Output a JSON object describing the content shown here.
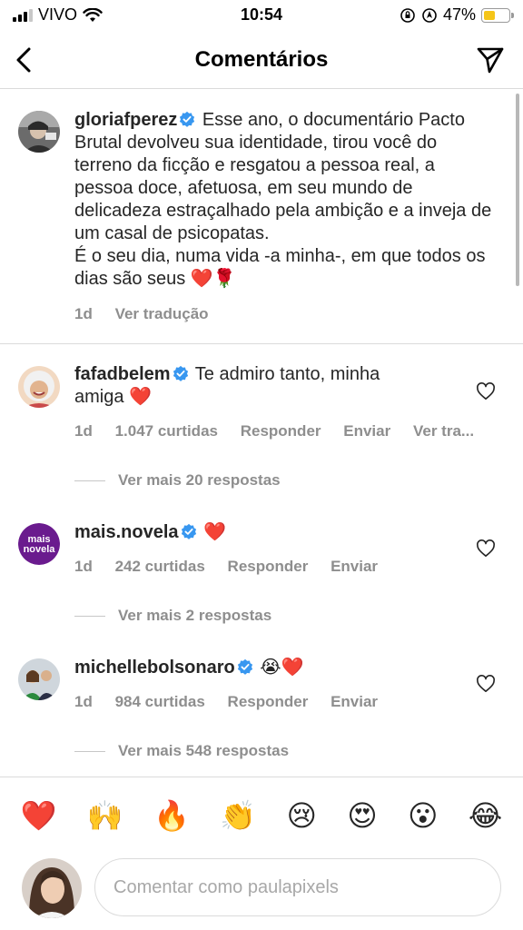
{
  "status_bar": {
    "carrier": "VIVO",
    "time": "10:54",
    "battery_percent": "47%",
    "battery_level": 0.47,
    "battery_color": "#f5c518"
  },
  "header": {
    "title": "Comentários"
  },
  "caption": {
    "username": "gloriafperez",
    "text": "Esse ano, o documentário Pacto Brutal devolveu sua identidade, tirou você do terreno da ficção e resgatou a pessoa real, a pessoa doce, afetuosa, em seu mundo de delicadeza  estraçalhado pela ambição e a inveja de um casal de psicopatas.",
    "text2": "É o seu dia, numa vida -a minha-, em que todos os dias são seus ❤️🌹",
    "time": "1d",
    "translate_label": "Ver tradução"
  },
  "comments": [
    {
      "username": "fafadbelem",
      "text": "Te admiro tanto, minha amiga ❤️",
      "time": "1d",
      "likes": "1.047 curtidas",
      "reply_label": "Responder",
      "send_label": "Enviar",
      "translate_label": "Ver tra...",
      "more_replies": "Ver mais 20 respostas"
    },
    {
      "username": "mais.novela",
      "text": "❤️",
      "time": "1d",
      "likes": "242 curtidas",
      "reply_label": "Responder",
      "send_label": "Enviar",
      "more_replies": "Ver mais 2 respostas",
      "avatar_text_1": "mais",
      "avatar_text_2": "novela",
      "avatar_color": "#6a1b8e"
    },
    {
      "username": "michellebolsonaro",
      "text": "😭❤️",
      "time": "1d",
      "likes": "984 curtidas",
      "reply_label": "Responder",
      "send_label": "Enviar",
      "more_replies": "Ver mais 548 respostas"
    }
  ],
  "reactions": [
    "❤️",
    "🙌",
    "🔥",
    "👏",
    "😢",
    "😍",
    "😮",
    "😂"
  ],
  "input": {
    "placeholder": "Comentar como paulapixels"
  },
  "colors": {
    "verified": "#3897f0",
    "meta_text": "#8e8e8e",
    "divider": "#dbdbdb"
  }
}
